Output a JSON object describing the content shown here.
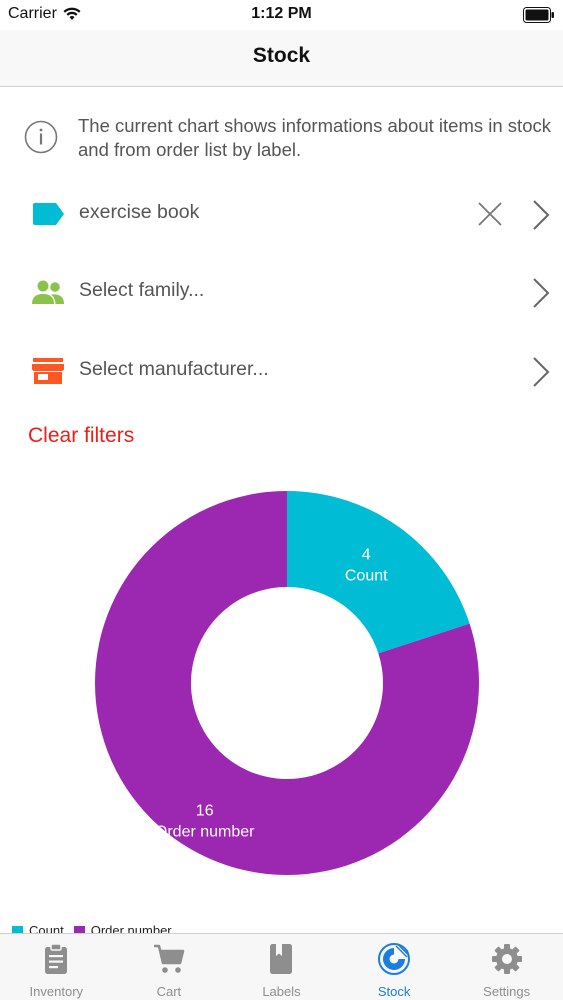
{
  "status_bar": {
    "carrier": "Carrier",
    "time": "1:12 PM"
  },
  "nav": {
    "title": "Stock"
  },
  "info": {
    "text": "The current chart shows  informations about items in stock and from order list by label."
  },
  "filters": {
    "label": {
      "value": "exercise book",
      "icon": "tag-icon",
      "color": "#00BCD4"
    },
    "family": {
      "placeholder": "Select family...",
      "icon": "people-icon",
      "color": "#8BC34A"
    },
    "manufacturer": {
      "placeholder": "Select manufacturer...",
      "icon": "store-icon",
      "color": "#FF5722"
    }
  },
  "clear_filters": "Clear filters",
  "chart_data": {
    "type": "pie",
    "donut": true,
    "slices": [
      {
        "name": "Count",
        "value": 4,
        "color": "#00BCD4"
      },
      {
        "name": "Order number",
        "value": 16,
        "color": "#9C27B0"
      }
    ],
    "legend": [
      "Count",
      "Order number"
    ],
    "legend_placement": "bottom-left"
  },
  "tabs": [
    {
      "label": "Inventory",
      "icon": "clipboard-icon",
      "active": false
    },
    {
      "label": "Cart",
      "icon": "cart-icon",
      "active": false
    },
    {
      "label": "Labels",
      "icon": "book-icon",
      "active": false
    },
    {
      "label": "Stock",
      "icon": "stock-icon",
      "active": true
    },
    {
      "label": "Settings",
      "icon": "gear-icon",
      "active": false
    }
  ],
  "colors": {
    "accent": "#1A7DE0",
    "danger": "#E8201A"
  }
}
